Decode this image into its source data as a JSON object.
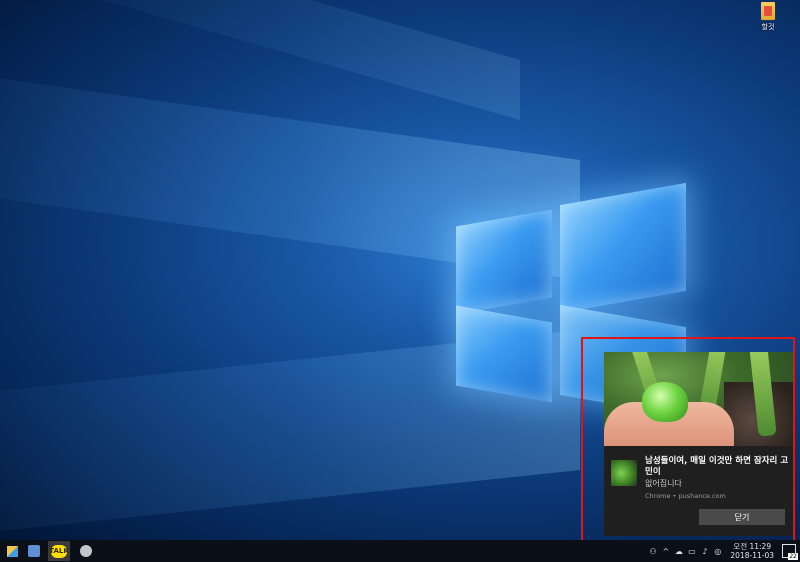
{
  "desktop": {
    "icons": [
      {
        "label": "할것",
        "icon": "folder-file-icon"
      }
    ]
  },
  "notification": {
    "title": "남성들이여, 매일 이것만 하면 잠자리 고민이",
    "message": "없어집니다",
    "source": "Chrome • pushance.com",
    "close_label": "닫기"
  },
  "taskbar": {
    "apps": [
      {
        "name": "start",
        "icon": "windows-start-icon"
      },
      {
        "name": "ie",
        "icon": "internet-explorer-icon"
      },
      {
        "name": "kakaotalk",
        "icon": "kakaotalk-icon",
        "label": "TALK"
      },
      {
        "name": "misc",
        "icon": "app-icon"
      }
    ],
    "tray": {
      "time": "오전 11:29",
      "date": "2018-11-03",
      "notification_count": "22"
    }
  },
  "colors": {
    "highlight": "#e01515",
    "toast_bg": "#1f1f1f",
    "taskbar_bg": "#0b0f17"
  }
}
